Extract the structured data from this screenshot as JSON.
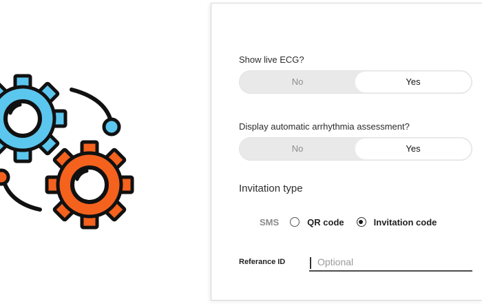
{
  "questions": [
    {
      "label": "Show live ECG?",
      "options": [
        "No",
        "Yes"
      ],
      "selected": "Yes"
    },
    {
      "label": "Display automatic arrhythmia assessment?",
      "options": [
        "No",
        "Yes"
      ],
      "selected": "Yes"
    }
  ],
  "invitation": {
    "title": "Invitation type",
    "sms_label": "SMS",
    "qr_label": "QR code",
    "code_label": "Invitation code",
    "selected": "Invitation code"
  },
  "reference": {
    "label": "Referance ID",
    "placeholder": "Optional",
    "value": ""
  },
  "colors": {
    "gear_blue": "#5bc6ee",
    "gear_orange": "#f5621e",
    "outline": "#111111"
  },
  "icons": [
    "settings-gears-illustration",
    "radio-unchecked-icon",
    "radio-checked-icon"
  ]
}
